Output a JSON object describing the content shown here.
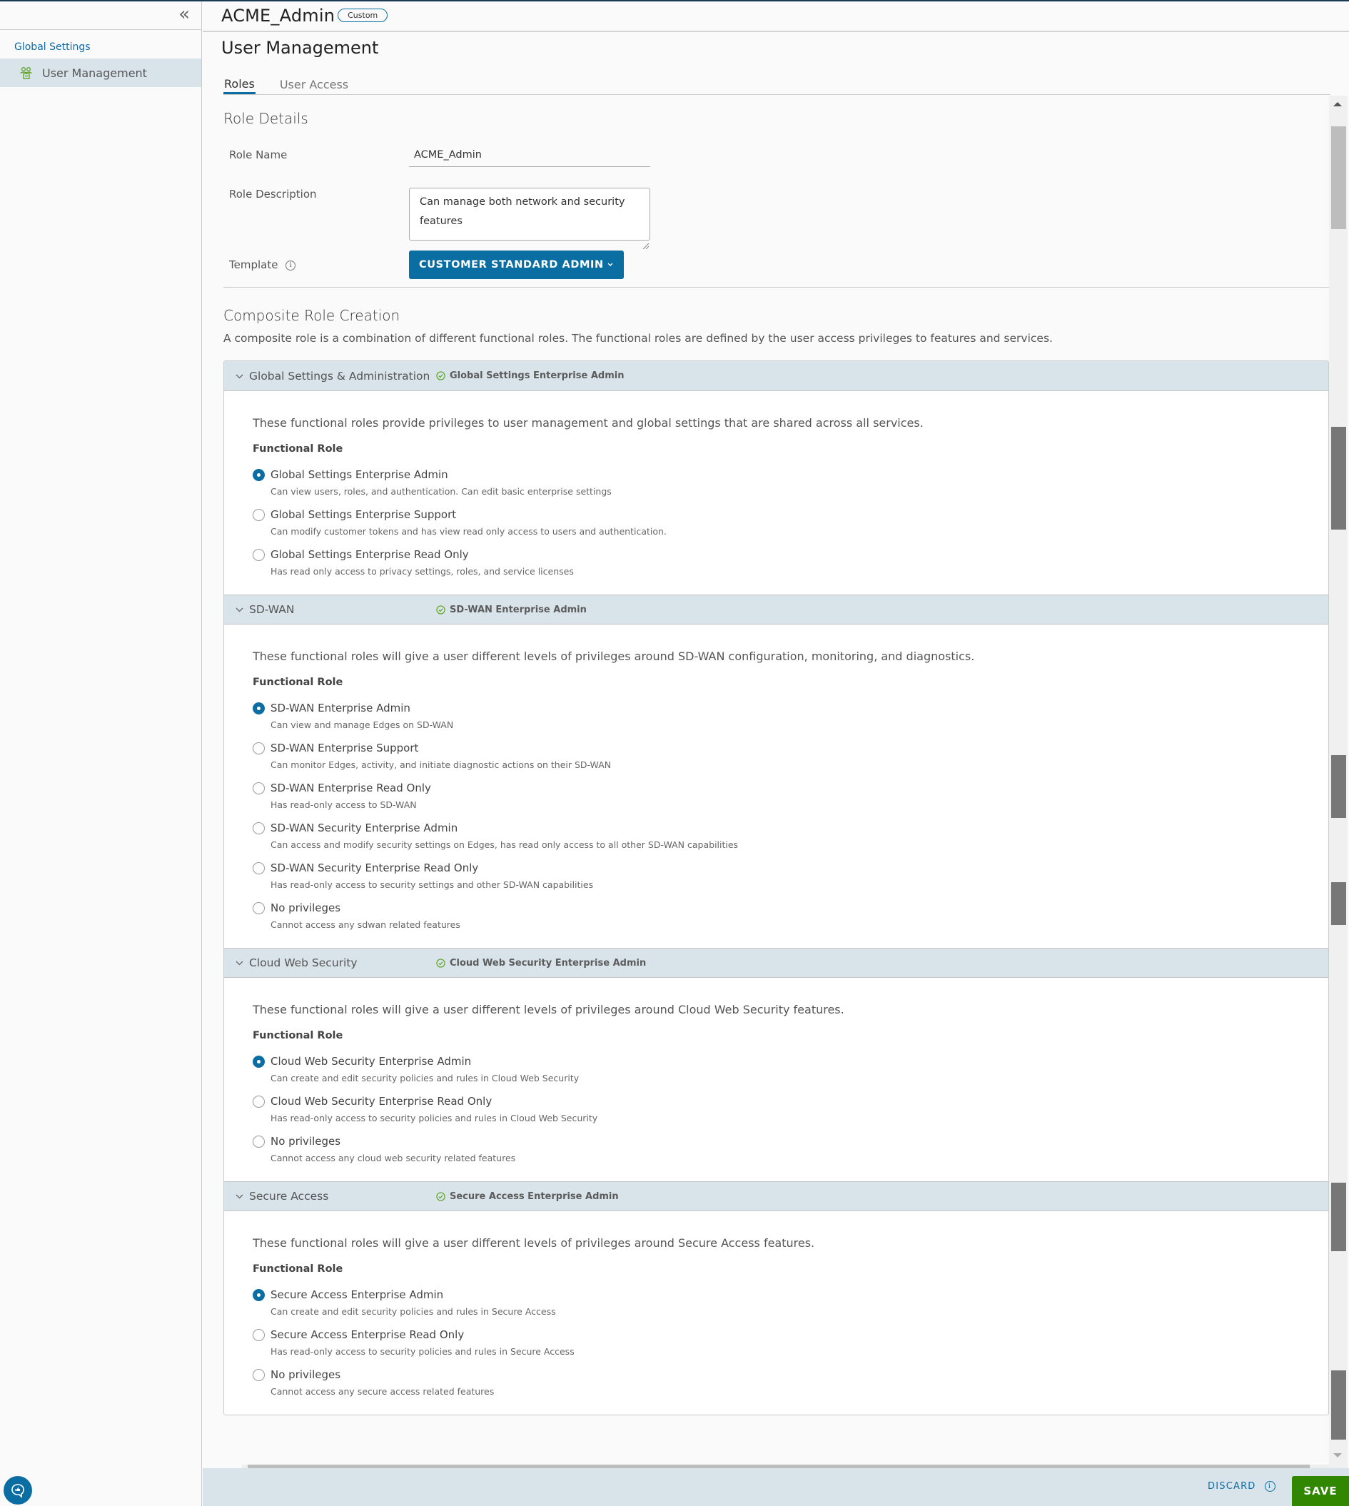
{
  "sidebar": {
    "collapse_icon": "double-chevron-left-icon",
    "section_label": "Global Settings",
    "items": [
      {
        "label": "User Management",
        "icon": "users-icon",
        "active": true
      }
    ],
    "feedback_icon": "feedback-chat-icon"
  },
  "header": {
    "role_title": "ACME_Admin",
    "badge": "Custom",
    "page_title": "User Management"
  },
  "tabs": [
    {
      "label": "Roles",
      "active": true
    },
    {
      "label": "User Access",
      "active": false
    }
  ],
  "role_details": {
    "title": "Role Details",
    "role_name_label": "Role Name",
    "role_name_value": "ACME_Admin",
    "role_description_label": "Role Description",
    "role_description_value": "Can manage both network and security features",
    "template_label": "Template",
    "template_value": "CUSTOMER STANDARD ADMIN"
  },
  "composite": {
    "title": "Composite Role Creation",
    "description": "A composite role is a combination of different functional roles. The functional roles are defined by the user access privileges to features and services.",
    "functional_role_label": "Functional Role",
    "sections": [
      {
        "title": "Global Settings & Administration",
        "selected": "Global Settings Enterprise Admin",
        "intro": "These functional roles provide privileges to user management and global settings that are shared across all services.",
        "options": [
          {
            "label": "Global Settings Enterprise Admin",
            "desc": "Can view users, roles, and authentication. Can edit basic enterprise settings",
            "checked": true
          },
          {
            "label": "Global Settings Enterprise Support",
            "desc": "Can modify customer tokens and has view read only access to users and authentication.",
            "checked": false
          },
          {
            "label": "Global Settings Enterprise Read Only",
            "desc": "Has read only access to privacy settings, roles, and service licenses",
            "checked": false
          }
        ]
      },
      {
        "title": "SD-WAN",
        "selected": "SD-WAN Enterprise Admin",
        "intro": "These functional roles will give a user different levels of privileges around SD-WAN configuration, monitoring, and diagnostics.",
        "options": [
          {
            "label": "SD-WAN Enterprise Admin",
            "desc": "Can view and manage Edges on SD-WAN",
            "checked": true
          },
          {
            "label": "SD-WAN Enterprise Support",
            "desc": "Can monitor Edges, activity, and initiate diagnostic actions on their SD-WAN",
            "checked": false
          },
          {
            "label": "SD-WAN Enterprise Read Only",
            "desc": "Has read-only access to SD-WAN",
            "checked": false
          },
          {
            "label": "SD-WAN Security Enterprise Admin",
            "desc": "Can access and modify security settings on Edges, has read only access to all other SD-WAN capabilities",
            "checked": false
          },
          {
            "label": "SD-WAN Security Enterprise Read Only",
            "desc": "Has read-only access to security settings and other SD-WAN capabilities",
            "checked": false
          },
          {
            "label": "No privileges",
            "desc": "Cannot access any sdwan related features",
            "checked": false
          }
        ]
      },
      {
        "title": "Cloud Web Security",
        "selected": "Cloud Web Security Enterprise Admin",
        "intro": "These functional roles will give a user different levels of privileges around Cloud Web Security features.",
        "options": [
          {
            "label": "Cloud Web Security Enterprise Admin",
            "desc": "Can create and edit security policies and rules in Cloud Web Security",
            "checked": true
          },
          {
            "label": "Cloud Web Security Enterprise Read Only",
            "desc": "Has read-only access to security policies and rules in Cloud Web Security",
            "checked": false
          },
          {
            "label": "No privileges",
            "desc": "Cannot access any cloud web security related features",
            "checked": false
          }
        ]
      },
      {
        "title": "Secure Access",
        "selected": "Secure Access Enterprise Admin",
        "intro": "These functional roles will give a user different levels of privileges around Secure Access features.",
        "options": [
          {
            "label": "Secure Access Enterprise Admin",
            "desc": "Can create and edit security policies and rules in Secure Access",
            "checked": true
          },
          {
            "label": "Secure Access Enterprise Read Only",
            "desc": "Has read-only access to security policies and rules in Secure Access",
            "checked": false
          },
          {
            "label": "No privileges",
            "desc": "Cannot access any secure access related features",
            "checked": false
          }
        ]
      }
    ]
  },
  "footer": {
    "discard_label": "DISCARD",
    "save_label": "SAVE"
  },
  "colors": {
    "accent": "#0b6ea3",
    "save_green": "#318700",
    "header_bg": "#d8e3ea",
    "check_green": "#5aa220"
  }
}
